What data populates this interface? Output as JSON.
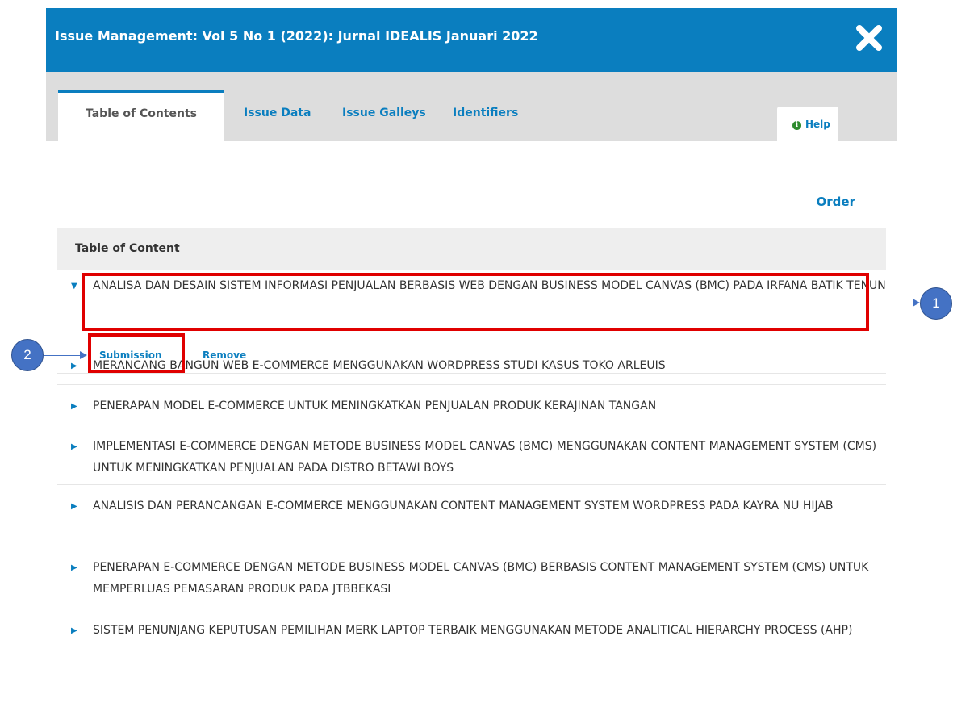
{
  "modal": {
    "title": "Issue Management: Vol 5 No 1 (2022): Jurnal IDEALIS Januari 2022",
    "close_icon": "close-x-icon"
  },
  "tabs": [
    {
      "label": "Table of Contents",
      "active": true
    },
    {
      "label": "Issue Data",
      "active": false
    },
    {
      "label": "Issue Galleys",
      "active": false
    },
    {
      "label": "Identifiers",
      "active": false
    }
  ],
  "help": {
    "icon_glyph": "i",
    "label": "Help"
  },
  "order_label": "Order",
  "toc": {
    "header": "Table of Content",
    "items": [
      {
        "title": "ANALISA DAN DESAIN SISTEM INFORMASI PENJUALAN BERBASIS WEB DENGAN BUSINESS MODEL CANVAS (BMC) PADA IRFANA BATIK TENUN",
        "expanded": true
      },
      {
        "title": "MERANCANG BANGUN WEB E-COMMERCE MENGGUNAKAN WORDPRESS STUDI KASUS TOKO ARLEUIS",
        "expanded": false
      },
      {
        "title": "PENERAPAN MODEL E-COMMERCE UNTUK MENINGKATKAN PENJUALAN PRODUK KERAJINAN TANGAN",
        "expanded": false
      },
      {
        "title": "IMPLEMENTASI E-COMMERCE DENGAN METODE BUSINESS MODEL CANVAS (BMC) MENGGUNAKAN CONTENT MANAGEMENT SYSTEM (CMS) UNTUK MENINGKATKAN PENJUALAN PADA DISTRO BETAWI BOYS",
        "expanded": false
      },
      {
        "title": "ANALISIS DAN PERANCANGAN E-COMMERCE MENGGUNAKAN CONTENT MANAGEMENT SYSTEM WORDPRESS PADA KAYRA NU HIJAB",
        "expanded": false
      },
      {
        "title": "PENERAPAN E-COMMERCE DENGAN METODE BUSINESS MODEL CANVAS (BMC) BERBASIS CONTENT MANAGEMENT SYSTEM (CMS) UNTUK MEMPERLUAS PEMASARAN PRODUK PADA JTBBEKASI",
        "expanded": false
      },
      {
        "title": "SISTEM PENUNJANG KEPUTUSAN PEMILIHAN MERK LAPTOP TERBAIK MENGGUNAKAN METODE ANALITICAL HIERARCHY PROCESS (AHP)",
        "expanded": false
      }
    ],
    "actions": {
      "submission": "Submission",
      "remove": "Remove"
    }
  },
  "annotations": {
    "callout_1": "1",
    "callout_2": "2"
  },
  "colors": {
    "header_bg": "#0a7ebf",
    "highlight": "#e00000",
    "callout": "#4472c4"
  }
}
